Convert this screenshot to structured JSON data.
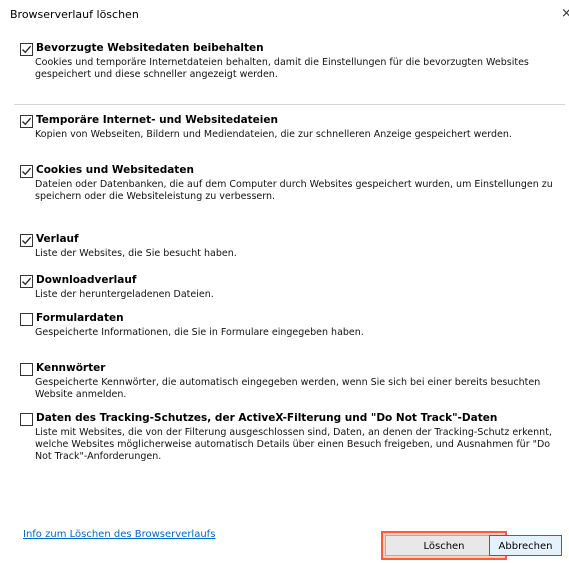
{
  "dialog": {
    "title": "Browserverlauf löschen",
    "close_glyph": "×"
  },
  "options": [
    {
      "label": "Bevorzugte Websitedaten beibehalten",
      "description": "Cookies und temporäre Internetdateien behalten, damit die Einstellungen für die bevorzugten Websites gespeichert und diese schneller angezeigt werden.",
      "checked": true
    },
    {
      "label": "Temporäre Internet- und Websitedateien",
      "description": "Kopien von Webseiten, Bildern und Mediendateien, die zur schnelleren Anzeige gespeichert werden.",
      "checked": true
    },
    {
      "label": "Cookies und Websitedaten",
      "description": "Dateien oder Datenbanken, die auf dem Computer durch Websites gespeichert wurden, um Einstellungen zu speichern oder die Websiteleistung zu verbessern.",
      "checked": true
    },
    {
      "label": "Verlauf",
      "description": "Liste der Websites, die Sie besucht haben.",
      "checked": true
    },
    {
      "label": "Downloadverlauf",
      "description": "Liste der heruntergeladenen Dateien.",
      "checked": true
    },
    {
      "label": "Formulardaten",
      "description": "Gespeicherte Informationen, die Sie in Formulare eingegeben haben.",
      "checked": false
    },
    {
      "label": "Kennwörter",
      "description": "Gespeicherte Kennwörter, die automatisch eingegeben werden, wenn Sie sich bei einer bereits besuchten Website anmelden.",
      "checked": false
    },
    {
      "label": "Daten des Tracking-Schutzes, der ActiveX-Filterung und \"Do Not Track\"-Daten",
      "description": "Liste mit Websites, die von der Filterung ausgeschlossen sind, Daten, an denen der Tracking-Schutz erkennt, welche Websites möglicherweise automatisch Details über einen Besuch freigeben, und Ausnahmen für \"Do Not Track\"-Anforderungen.",
      "checked": false
    }
  ],
  "footer": {
    "info_link": "Info zum Löschen des Browserverlaufs",
    "delete_button": "Löschen",
    "cancel_button": "Abbrechen"
  },
  "colors": {
    "link": "#0066cc",
    "highlight": "#ff5a3c",
    "default_button_border": "#0078d7"
  }
}
